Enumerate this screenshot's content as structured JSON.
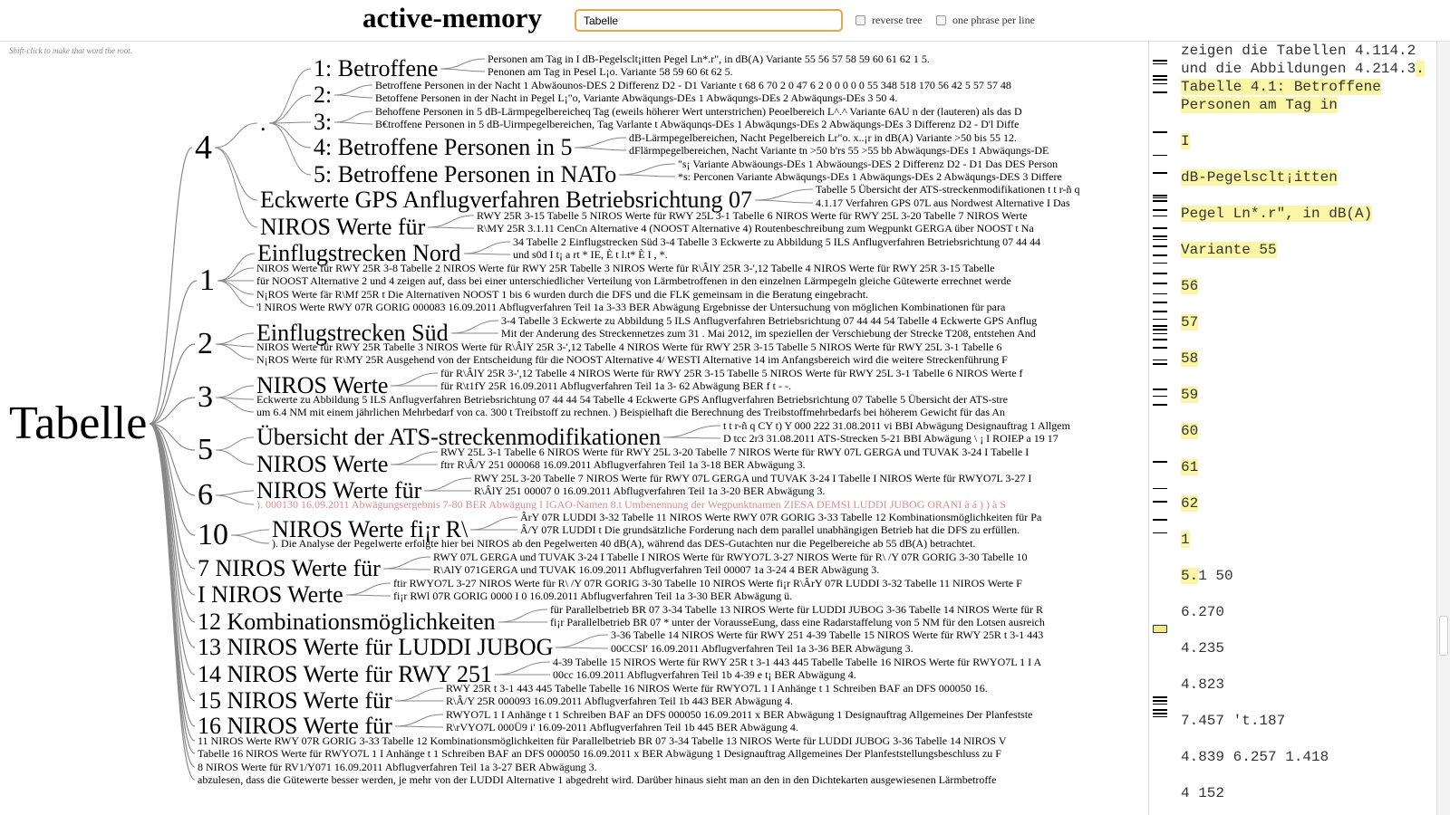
{
  "app": {
    "title": "active-memory",
    "search_value": "Tabelle",
    "options": [
      "reverse tree",
      "one phrase per line"
    ],
    "hint": "Shift-click to make that word the root."
  },
  "tree": {
    "root": "Tabelle",
    "nodes": [
      {
        "id": "n4",
        "text": "4",
        "size": 38
      },
      {
        "id": "ndot",
        "text": ".",
        "size": 26
      },
      {
        "id": "l1",
        "text": "1: Betroffene",
        "size": 26
      },
      {
        "id": "l2",
        "text": "2:",
        "size": 26
      },
      {
        "id": "l3",
        "text": "3:",
        "size": 26
      },
      {
        "id": "l4",
        "text": "4: Betroffene Personen in 5",
        "size": 26
      },
      {
        "id": "l5",
        "text": "5: Betroffene Personen in NATo",
        "size": 26
      },
      {
        "id": "eck",
        "text": "Eckwerte GPS Anflugverfahren Betriebsrichtung 07",
        "size": 26
      },
      {
        "id": "nir4",
        "text": "NIROS Werte für",
        "size": 26
      },
      {
        "id": "n1",
        "text": "1",
        "size": 34
      },
      {
        "id": "einn",
        "text": "Einflugstrecken Nord",
        "size": 26
      },
      {
        "id": "n2",
        "text": "2",
        "size": 34
      },
      {
        "id": "eins",
        "text": "Einflugstrecken Süd",
        "size": 26
      },
      {
        "id": "n3",
        "text": "3",
        "size": 34
      },
      {
        "id": "nir3",
        "text": "NIROS Werte",
        "size": 26
      },
      {
        "id": "n5",
        "text": "5",
        "size": 34
      },
      {
        "id": "ueb",
        "text": "Übersicht der ATS-streckenmodifikationen",
        "size": 26
      },
      {
        "id": "nir5",
        "text": "NIROS Werte",
        "size": 26
      },
      {
        "id": "n6",
        "text": "6",
        "size": 34
      },
      {
        "id": "nir6",
        "text": "NIROS Werte für",
        "size": 26
      },
      {
        "id": "n10",
        "text": "10",
        "size": 34
      },
      {
        "id": "nir10",
        "text": "NIROS Werte fi¡r R\\",
        "size": 26
      },
      {
        "id": "s7",
        "text": "7 NIROS Werte für",
        "size": 26
      },
      {
        "id": "sI",
        "text": "I NIROS Werte",
        "size": 26
      },
      {
        "id": "s12",
        "text": "12 Kombinationsmöglichkeiten",
        "size": 26
      },
      {
        "id": "s13",
        "text": "13 NIROS Werte für LUDDI JUBOG",
        "size": 26
      },
      {
        "id": "s14",
        "text": "14 NIROS Werte für RWY 251",
        "size": 26
      },
      {
        "id": "s15",
        "text": "15 NIROS Werte für",
        "size": 26
      },
      {
        "id": "s16",
        "text": "16 NIROS Werte für",
        "size": 26
      }
    ],
    "phrases": [
      {
        "id": "p1",
        "text": "Personen am Tag in I dB-Pegelsclt¡itten Pegel Ln*.r\", in dB(A) Variante 55 56 57 58 59 60 61 62 1 5."
      },
      {
        "id": "p2",
        "text": "Penonen am Tag in Pesel L¡o. Variante 58 59 60 6t 62 5."
      },
      {
        "id": "p3",
        "text": "Betroffene Personen in der Nacht 1 Abwäounos-DES 2 Differenz D2 - D1 Variante t 68 6 70 2 0 47 6 2 0 0 0 0 0 55 348 518 170 56 42 5 57 57 48"
      },
      {
        "id": "p4",
        "text": "Betoffene Personen in der Nacht in Pegel L¡\"o, Variante Abwäqungs-DEs 1 Abwäqungs-DEs 2 Abwäqungs-DEs 3 50 4."
      },
      {
        "id": "p5",
        "text": "Behoffene Personen in 5 dB-Lärmpegelbereicheq Tag (eweils höherer Wert unterstrichen) Peoelbereich L^.^ Variante 6AU n der (lauteren) als das D"
      },
      {
        "id": "p6",
        "text": "B€troffene Personen in 5 dB-Uirmpegelbereichen, Tag Varlante t Abwäqunqs-DEs 1 Abwäqungs-DEs 2 Abwäqungs-DEs 3 Differenz D2 - D'l Diffe"
      },
      {
        "id": "p7",
        "text": "dB-Lärmpegelbereichen, Nacht Pegelbereich Lr\"o. x..¡r in dB(A) Variante >50 bis 55 12."
      },
      {
        "id": "p8",
        "text": "dFlärmpegelbereichen, Nacht Variante tn >50 b'rs 55 >55 bb Abwäqungs-DEs 1 Abwäqungs-DE"
      },
      {
        "id": "p9",
        "text": "\"s¡ Variante Abwäoungs-DEs 1 Abwäoungs-DES 2 Differenz D2 - D1 Das DES Person"
      },
      {
        "id": "p10",
        "text": "*s: Perconen Variante Abwäqungs-DEs 1 Abwäqungs-DEs 2 Abwäqungs-DES 3 Differe"
      },
      {
        "id": "p11",
        "text": "Tabelle 5 Übersicht der ATS-streckenmodifikationen t t r-ñ q"
      },
      {
        "id": "p12",
        "text": "4.1.17 Verfahren GPS 07L aus Nordwest Alternative I Das"
      },
      {
        "id": "p13",
        "text": "RWY 25R 3-15 Tabelle 5 NIROS Werte für RWY 25L 3-1 Tabelle 6 NIROS Werte für RWY 25L 3-20 Tabelle 7 NIROS Werte"
      },
      {
        "id": "p14",
        "text": "R\\MY 25R 3.1.11 CenCn Alternative 4 (NOOST Alternative 4) Routenbeschreibung zum Wegpunkt GERGA über NOOST t Na"
      },
      {
        "id": "p15",
        "text": "34 Tabelle 2 Einflugstrecken Süd 3-4 Tabelle 3 Eckwerte zu Abbildung 5 ILS Anflugverfahren Betriebsrichtung 07 44 44"
      },
      {
        "id": "p16",
        "text": "und s0d I t¡ a rt * IE, È t l.t* È I , *."
      },
      {
        "id": "p17",
        "text": "NIROS Werte für RWY 25R 3-8 Tabelle 2 NIROS Werte für RWY 25R Tabelle 3 NIROS Werte für R\\ÂlY 25R 3-',12 Tabelle 4 NIROS Werte für RWY 25R 3-15 Tabelle"
      },
      {
        "id": "p18",
        "text": "für NOOST Alternative 2 und 4 zeigen auf, dass bei einer unterschiedlicher Verteilung von Lärmbetroffenen in den einzelnen Lärmpegeln gleiche Gütewerte errechnet werde"
      },
      {
        "id": "p19",
        "text": "N¡ROS Werte fär R\\Mf 25R t Die Alternativen NOOST 1 bis 6 wurden durch die DFS und die FLK gemeinsam in die Beratung eingebracht."
      },
      {
        "id": "p20",
        "text": "'l NIROS Werte RWY 07R GORIG 000083 16.09.2011 Abflugverfahren Teil 1a 3-33 BER Abwägung Ergebnisse der Untersuchung von möglichen Kombinationen für para"
      },
      {
        "id": "p21",
        "text": "3-4 Tabelle 3 Eckwerte zu Abbildung 5 ILS Anflugverfahren Betriebsrichtung 07 44 44 54 Tabelle 4 Eckwerte GPS Anflug"
      },
      {
        "id": "p22",
        "text": "Mit der Anderung des Streckennetzes zum 31 . Mai 2012, im speziellen der Verschiebung der Strecke T208, entstehen And"
      },
      {
        "id": "p23",
        "text": "NIROS Werte für RWY 25R Tabelle 3 NIROS Werte für R\\ÂlY 25R 3-',12 Tabelle 4 NIROS Werte für RWY 25R 3-15 Tabelle 5 NIROS Werte für RWY 25L 3-1 Tabelle 6"
      },
      {
        "id": "p24",
        "text": "N¡ROS Werte für R\\MY 25R Ausgehend von der Entscheidung für die NOOST Alternative 4/ WESTI Alternative 14 im Anfangsbereich wird die weitere Streckenführung F"
      },
      {
        "id": "p25",
        "text": "für R\\ÂlY 25R 3-',12 Tabelle 4 NIROS Werte für RWY 25R 3-15 Tabelle 5 NIROS Werte für RWY 25L 3-1 Tabelle 6 NIROS Werte f"
      },
      {
        "id": "p26",
        "text": "für R\\t1fY 25R 16.09.2011 Abflugverfahren Teil 1a 3- 62 Abwägung BER f t - -."
      },
      {
        "id": "p27",
        "text": "Eckwerte zu Abbildung 5 ILS Anflugverfahren Betriebsrichtung 07 44 44 54 Tabelle 4 Eckwerte GPS Anflugverfahren Betriebsrichtung 07 Tabelle 5 Übersicht der ATS-stre"
      },
      {
        "id": "p28",
        "text": "um 6.4 NM mit einem jährlichen Mehrbedarf von ca. 300 t Treibstoff zu rechnen. ) Beispielhaft die Berechnung des Treibstoffmehrbedarfs bei höherem Gewicht für das An"
      },
      {
        "id": "p29",
        "text": "t t r-ñ q CY t) Y 000 222 31.08.2011 vi BBI Abwägung Designauftrag 1 Allgem"
      },
      {
        "id": "p30",
        "text": "D tcc 2r3 31.08.2011 ATS-Strecken 5-21 BBI Abwägung \\ ¡ I ROIEP a 19 17"
      },
      {
        "id": "p31",
        "text": "RWY 25L 3-1 Tabelle 6 NIROS Werte für RWY 25L 3-20 Tabelle 7 NIROS Werte für RWY 07L GERGA und TUVAK 3-24 I Tabelle I"
      },
      {
        "id": "p32",
        "text": "ftrr R\\Â/Y 251 000068 16.09.2011 Abflugverfahren Teil 1a 3-18 BER Abwägung 3."
      },
      {
        "id": "p33",
        "text": "RWY 25L 3-20 Tabelle 7 NIROS Werte für RWY 07L GERGA und TUVAK 3-24 I Tabelle I NIROS Werte für RWYO7L 3-27 I"
      },
      {
        "id": "p34",
        "text": "R\\ÂlY 251 00007 0 16.09.2011 Abflugverfahren Teil 1a 3-20 BER Abwägung 3."
      },
      {
        "id": "p35",
        "text": "). 000130 16.09.2011 Abwägungsergebnis 7-80 BER Abwägung I IGAO-Namen 8.t Umbenennung der Wegpunktnamen ZIESA DEMSI LUDDI JUBOG ORANI à á ) ) à S"
      },
      {
        "id": "p36",
        "text": "ÂrY 07R LUDDI 3-32 Tabelle 11 NIROS Werte RWY 07R GORIG 3-33 Tabelle 12 Kombinationsmöglichkeiten für Pa"
      },
      {
        "id": "p37",
        "text": "Â/Y 07R LUDDI t Die grundsätzliche Forderung nach dem parallel unabhängigen Betrieb hat die DFS zu erfüllen."
      },
      {
        "id": "p38",
        "text": "). Die Analyse der Pegelwerte erfolgte hier bei NIROS ab den Pegelwerten 40 dB(A), während das DES-Gutachten nur die Pegelbereiche ab 55 dB(A) betrachtet."
      },
      {
        "id": "p39",
        "text": "RWY 07L GERGA und TUVAK 3-24 I Tabelle I NIROS Werte für RWYO7L 3-27 NIROS Werte für R\\ /Y 07R GORIG 3-30 Tabelle 10"
      },
      {
        "id": "p40",
        "text": "R\\AlY 071GERGA und TUVAK 16.09.2011 Abflugverfahren Teil 00007 1a 3-24 4 BER Abwägung 3."
      },
      {
        "id": "p41",
        "text": "ftir RWYO7L 3-27 NIROS Werte für R\\ /Y 07R GORIG 3-30 Tabelle 10 NIROS Werte fi¡r R\\ÂrY 07R LUDDI 3-32 Tabelle 11 NIROS Werte F"
      },
      {
        "id": "p42",
        "text": "fi¡r RWl 07R GORIG 0000 I 0 16.09.2011 Abflugverfahren Teil 1a 3-30 BER Abwägung ü."
      },
      {
        "id": "p43",
        "text": "für Parallelbetrieb BR 07 3-34 Tabelle 13 NIROS Werte für LUDDI JUBOG 3-36 Tabelle 14 NIROS Werte für R"
      },
      {
        "id": "p44",
        "text": "fi¡r Parallelbetrieb BR 07 * unter der VorausseEung, dass eine Radarstaffelung von 5 NM für den Lotsen ausreich"
      },
      {
        "id": "p45",
        "text": "3-36 Tabelle 14 NIROS Werte für RWY 251 4-39 Tabelle 15 NIROS Werte für RWY 25R t 3-1 443"
      },
      {
        "id": "p46",
        "text": "00CCSI' 16.09.2011 Abflugverfahren Teil 1a 3-36 BER Abwägung 3."
      },
      {
        "id": "p47",
        "text": "4-39 Tabelle 15 NIROS Werte für RWY 25R t 3-1 443 445 Tabelle Tabelle 16 NIROS Werte für RWYO7L 1 I A"
      },
      {
        "id": "p48",
        "text": "00cc 16.09.2011 Abflugverfahren Teil 1b 4-39 e t¡ BER Abwägung 4."
      },
      {
        "id": "p49",
        "text": "RWY 25R t 3-1 443 445 Tabelle Tabelle 16 NIROS Werte für RWYO7L 1 I Anhänge t 1 Schreiben BAF an DFS 000050 16."
      },
      {
        "id": "p50",
        "text": "R\\Â/Y 25R 000093 16.09.2011 Abflugverfahren Teil 1b 443 BER Abwägung 4."
      },
      {
        "id": "p51",
        "text": "RWYO7L 1 I Anhänge t 1 Schreiben BAF an DFS 000050 16.09.2011 x BER Abwägung 1 Designauftrag Allgemeines Der Planfestste"
      },
      {
        "id": "p52",
        "text": "R\\rVYO7L 000Ü9 i' 16.09-2011 Abflugverfahren Teil 1b 445 BER Abwägung 4."
      },
      {
        "id": "p53",
        "text": "11 NIROS Werte RWY 07R GORIG 3-33 Tabelle 12 Kombinationsmöglichkeiten für Parallelbetrieb BR 07 3-34 Tabelle 13 NIROS Werte für LUDDI JUBOG 3-36 Tabelle 14 NIROS V"
      },
      {
        "id": "p54",
        "text": "Tabelle 16 NIROS Werte für RWYO7L 1 I Anhänge t 1 Schreiben BAF an DFS 000050 16.09.2011 x BER Abwägung 1 Designauftrag Allgemeines Der Planfeststellungsbeschluss zu F"
      },
      {
        "id": "p55",
        "text": "8 NIROS Werte für RV1/Y071 16.09.2011 Abflugverfahren Teil 1a 3-27 BER Abwägung 3."
      },
      {
        "id": "p56",
        "text": "abzulesen, dass die Gütewerte besser werden, je mehr von der LUDDI Alternative 1 abgedreht wird. Darüber hinaus sieht man an den in den Dichtekarten ausgewiesenen Lärmbetroffe"
      }
    ]
  },
  "text_pane": {
    "lines": [
      {
        "text": "zeigen die Tabellen 4.114.2"
      },
      {
        "text": "und die Abbildungen 4.214.3.",
        "hl_tail": "."
      },
      {
        "text": "Tabelle 4.1: Betroffene",
        "hl": true
      },
      {
        "text": "Personen am Tag in",
        "hl": true
      },
      {
        "text": "I",
        "hl": true
      },
      {
        "text": "dB-Pegelsclt¡itten",
        "hl": true
      },
      {
        "text": "Pegel Ln*.r\", in dB(A)",
        "hl": true
      },
      {
        "text": "Variante 55",
        "hl": true
      },
      {
        "text": "56",
        "hl": true
      },
      {
        "text": "57",
        "hl": true
      },
      {
        "text": "58",
        "hl": true
      },
      {
        "text": "59",
        "hl": true
      },
      {
        "text": "60",
        "hl": true
      },
      {
        "text": "61",
        "hl": true
      },
      {
        "text": "62",
        "hl": true
      },
      {
        "text": "1",
        "hl": true
      },
      {
        "text": "5.1 50",
        "hl_head": "5."
      },
      {
        "text": "6.270"
      },
      {
        "text": "4.235"
      },
      {
        "text": "4.823"
      },
      {
        "text": "7.457 't.187"
      },
      {
        "text": "4.839 6.257 1.418"
      },
      {
        "text": "4 152"
      }
    ]
  }
}
